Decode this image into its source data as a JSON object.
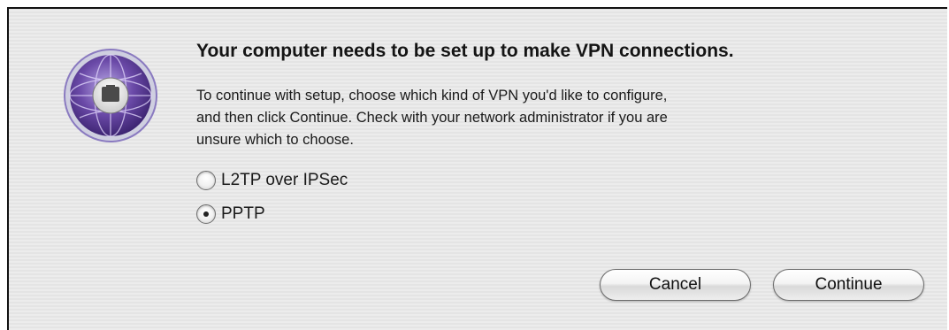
{
  "dialog": {
    "headline": "Your computer needs to be set up to make VPN connections.",
    "body_lines": [
      "To continue with setup, choose which kind of VPN you'd like to configure,",
      "and then click Continue. Check with your network administrator if you are",
      "unsure which to choose."
    ],
    "options": [
      {
        "label": "L2TP over IPSec",
        "selected": false
      },
      {
        "label": "PPTP",
        "selected": true
      }
    ],
    "buttons": {
      "cancel": "Cancel",
      "continue": "Continue"
    },
    "icon": "network-preferences-icon",
    "colors": {
      "icon_purple": "#6b4aa8",
      "icon_ring": "#8a7ac0"
    }
  }
}
